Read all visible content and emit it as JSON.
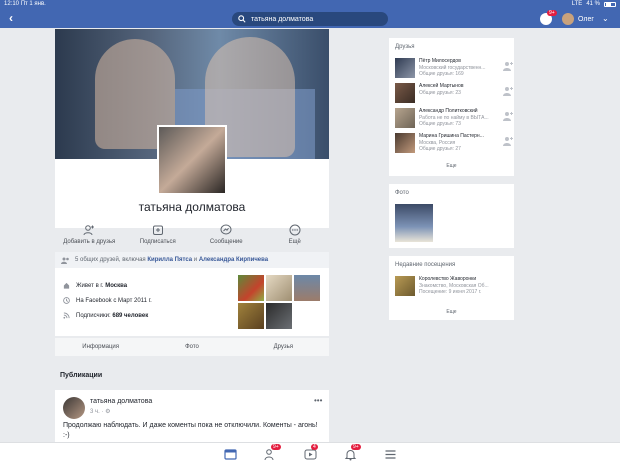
{
  "status": {
    "time": "12:10",
    "date": "Пт 1 янв.",
    "signal": "LTE",
    "battery": "41 %"
  },
  "search": {
    "query": "татьяна долматова"
  },
  "header": {
    "user_name": "Олег",
    "notifications_badge": "9+"
  },
  "profile": {
    "name": "татьяна долматова",
    "actions": [
      {
        "label": "Добавить в друзья",
        "icon": "add-friend-icon"
      },
      {
        "label": "Подписаться",
        "icon": "follow-icon"
      },
      {
        "label": "Сообщение",
        "icon": "messenger-icon"
      },
      {
        "label": "Ещё",
        "icon": "more-icon"
      }
    ],
    "mutual": {
      "prefix": "5 общих друзей, включая",
      "friend1": "Кирилла Пятса",
      "joiner": "и",
      "friend2": "Александра Кирпичева"
    },
    "info": {
      "lives_prefix": "Живет в г.",
      "lives_city": "Москва",
      "since": "На Facebook с Март 2011 г.",
      "followers_prefix": "Подписчики:",
      "followers_count": "689 человек"
    },
    "tabs": [
      "Информация",
      "Фото",
      "Друзья"
    ]
  },
  "publications": {
    "title": "Публикации",
    "post": {
      "author": "татьяна долматова",
      "time": "3 ч.",
      "text": "Продолжаю наблюдать. И даже коменты пока не отключили. Коменты - агонь! :-)"
    }
  },
  "right": {
    "friends": {
      "title": "Друзья",
      "items": [
        {
          "name": "Пётр Милосердов",
          "sub": "Московский государственн...",
          "mutual": "Общие друзья: 169"
        },
        {
          "name": "Алексей Мартынов",
          "sub": "",
          "mutual": "Общие друзья: 23"
        },
        {
          "name": "Александр Политковский",
          "sub": "Работа не по найму в ВЫТА...",
          "mutual": "Общие друзья: 73"
        },
        {
          "name": "Марина Гришина Пастерн...",
          "sub": "Москва, Россия",
          "mutual": "Общие друзья: 27"
        }
      ],
      "more": "Еще"
    },
    "photos": {
      "title": "Фото"
    },
    "visits": {
      "title": "Недавние посещения",
      "item": {
        "name": "Королевство Жаворонки",
        "sub": "Знакомство, Московская Об...",
        "date": "Посещение: 9 июня 2017 г."
      },
      "more": "Еще"
    }
  },
  "bottom_nav": {
    "friends_badge": "9+",
    "video_badge": "4",
    "notif_badge": "9+"
  }
}
